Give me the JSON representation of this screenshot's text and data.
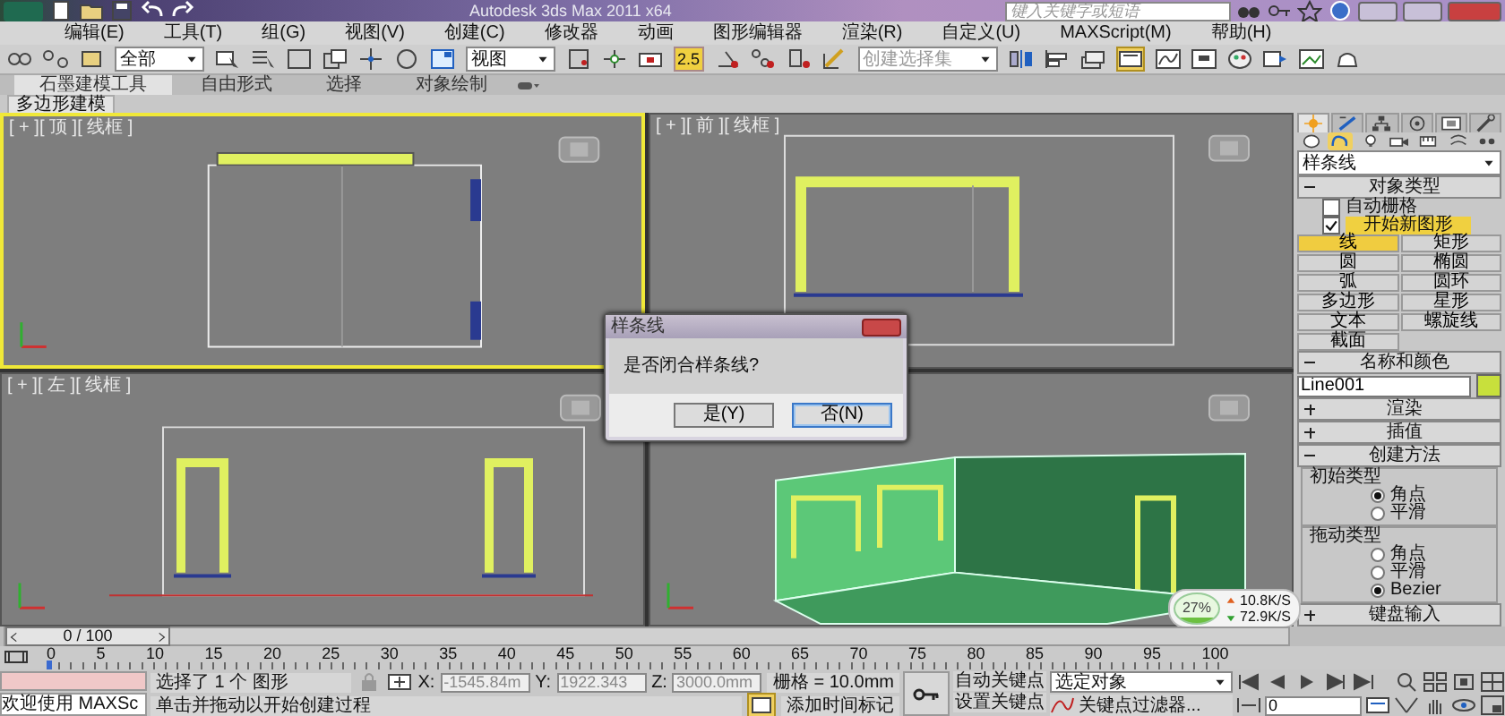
{
  "title_bar": {
    "title": "Autodesk 3ds Max  2011 x64",
    "search": {
      "placeholder": "键入关键字或短语"
    }
  },
  "menu": [
    "编辑(E)",
    "工具(T)",
    "组(G)",
    "视图(V)",
    "创建(C)",
    "修改器",
    "动画",
    "图形编辑器",
    "渲染(R)",
    "自定义(U)",
    "MAXScript(M)",
    "帮助(H)"
  ],
  "toolbar": {
    "selection_filter": "全部",
    "reference_coord": "视图",
    "snap_label": "2.5",
    "named_selection": {
      "placeholder": "创建选择集"
    }
  },
  "ribbon": {
    "tabs": [
      {
        "label": "石墨建模工具",
        "selected": true
      },
      {
        "label": "自由形式",
        "selected": false
      },
      {
        "label": "选择",
        "selected": false
      },
      {
        "label": "对象绘制",
        "selected": false
      }
    ],
    "panel": "多边形建模"
  },
  "viewports": [
    {
      "kind": "top",
      "label": "[ + ][ 顶 ][ 线框 ]",
      "active": true
    },
    {
      "kind": "front",
      "label": "[ + ][ 前 ][ 线框 ]",
      "active": false
    },
    {
      "kind": "left",
      "label": "[ + ][ 左 ][ 线框 ]",
      "active": false
    },
    {
      "kind": "perspective",
      "active": false
    }
  ],
  "dialog": {
    "title": "样条线",
    "message": "是否闭合样条线?",
    "buttons": [
      {
        "label": "是(Y)",
        "selected": false
      },
      {
        "label": "否(N)",
        "selected": true
      }
    ]
  },
  "network": {
    "percent": "27%",
    "up": "10.8K/S",
    "down": "72.9K/S"
  },
  "command_panel": {
    "tabs": [
      {
        "kind": "create",
        "selected": true
      },
      {
        "kind": "modify",
        "selected": false
      },
      {
        "kind": "hierarchy",
        "selected": false
      },
      {
        "kind": "motion",
        "selected": false
      },
      {
        "kind": "display",
        "selected": false
      },
      {
        "kind": "utilities",
        "selected": false
      }
    ],
    "categories": [
      {
        "kind": "geometry",
        "selected": false
      },
      {
        "kind": "shapes",
        "selected": true
      },
      {
        "kind": "lights",
        "selected": false
      },
      {
        "kind": "cameras",
        "selected": false
      },
      {
        "kind": "helpers",
        "selected": false
      },
      {
        "kind": "spacewarps",
        "selected": false
      },
      {
        "kind": "systems",
        "selected": false
      }
    ],
    "category": "样条线",
    "object_type": {
      "title": "对象类型",
      "expanded": true,
      "checkboxes": [
        {
          "label": "自动栅格",
          "checked": false,
          "highlighted": false
        },
        {
          "label": "开始新图形",
          "checked": true,
          "highlighted": true
        }
      ],
      "buttons": [
        {
          "label": "线",
          "selected": true
        },
        {
          "label": "矩形",
          "selected": false
        },
        {
          "label": "圆",
          "selected": false
        },
        {
          "label": "椭圆",
          "selected": false
        },
        {
          "label": "弧",
          "selected": false
        },
        {
          "label": "圆环",
          "selected": false
        },
        {
          "label": "多边形",
          "selected": false
        },
        {
          "label": "星形",
          "selected": false
        },
        {
          "label": "文本",
          "selected": false
        },
        {
          "label": "螺旋线",
          "selected": false
        },
        {
          "label": "截面",
          "selected": false
        }
      ]
    },
    "name_color": {
      "title": "名称和颜色",
      "expanded": true,
      "name": "Line001",
      "color": "#c8e03c"
    },
    "rollouts": [
      {
        "title": "渲染",
        "expanded": false
      },
      {
        "title": "插值",
        "expanded": false
      }
    ],
    "creation_method": {
      "title": "创建方法",
      "expanded": true,
      "groups": [
        {
          "title": "初始类型",
          "options": [
            {
              "label": "角点",
              "selected": true
            },
            {
              "label": "平滑",
              "selected": false
            }
          ]
        },
        {
          "title": "拖动类型",
          "options": [
            {
              "label": "角点",
              "selected": false
            },
            {
              "label": "平滑",
              "selected": false
            },
            {
              "label": "Bezier",
              "selected": true
            }
          ]
        }
      ]
    },
    "keyboard_entry": {
      "title": "键盘输入",
      "expanded": false
    }
  },
  "time_slider": {
    "label": "0 / 100",
    "level": 0
  },
  "ruler": [
    "0",
    "5",
    "10",
    "15",
    "20",
    "25",
    "30",
    "35",
    "40",
    "45",
    "50",
    "55",
    "60",
    "65",
    "70",
    "75",
    "80",
    "85",
    "90",
    "95",
    "100"
  ],
  "status": {
    "maxscript": "欢迎使用 MAXSc",
    "prompt": "选择了 1 个 图形",
    "hint": "单击并拖动以开始创建过程",
    "coords": [
      {
        "axis": "X:",
        "value": "-1545.84m"
      },
      {
        "axis": "Y:",
        "value": "1922.343"
      },
      {
        "axis": "Z:",
        "value": "3000.0mm"
      }
    ],
    "grid": "栅格 = 10.0mm",
    "add_time_tag": "添加时间标记",
    "auto_key": "自动关键点",
    "set_key": "设置关键点",
    "key_mode": "选定对象",
    "key_filters": "关键点过滤器...",
    "frame": "0"
  }
}
